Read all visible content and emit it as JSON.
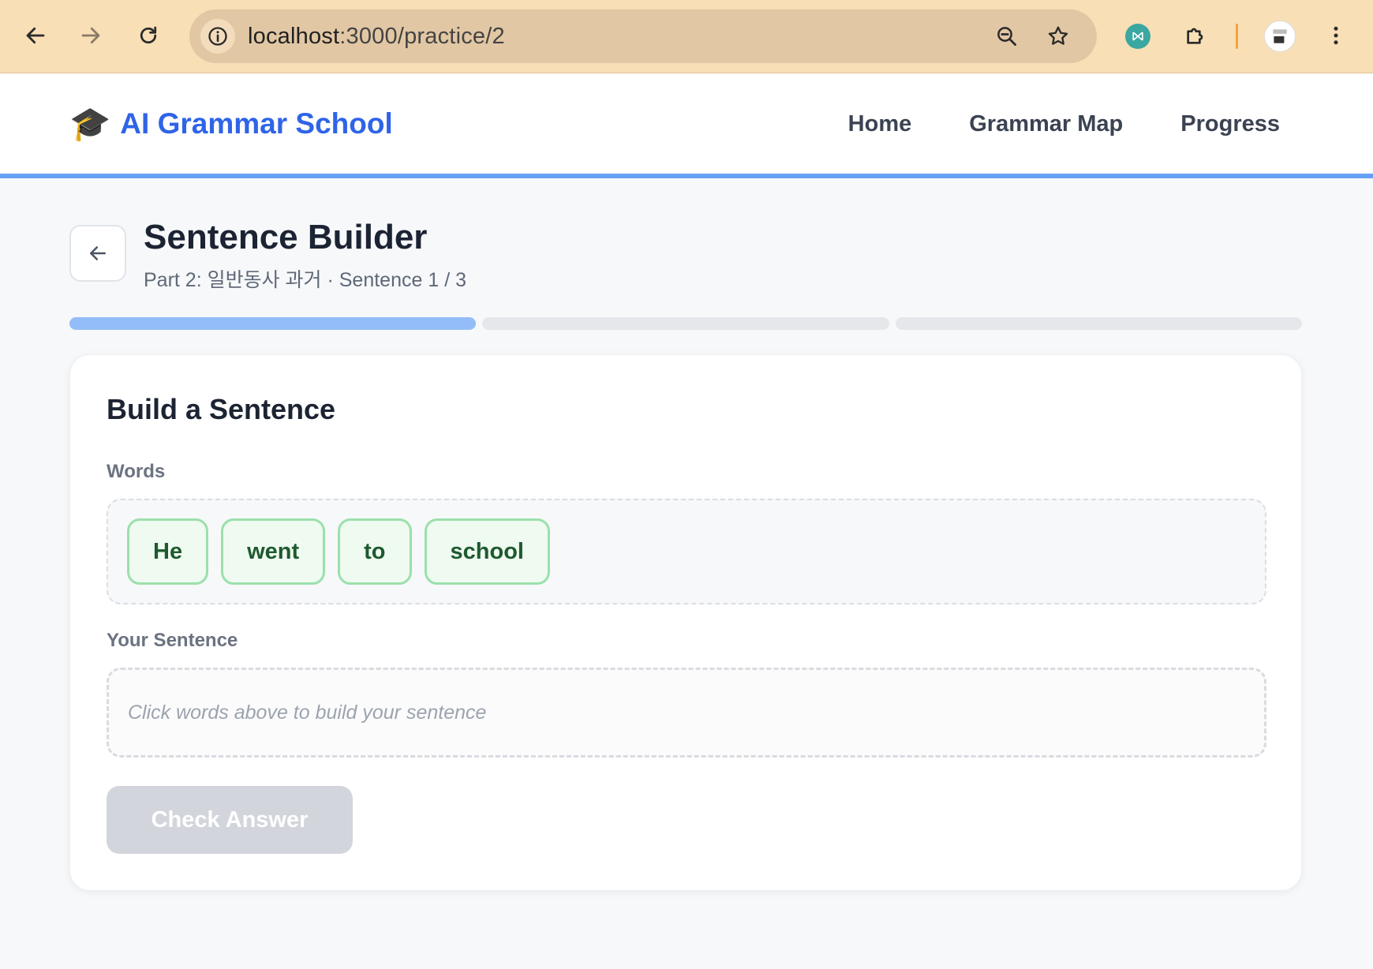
{
  "browser": {
    "url_host": "localhost",
    "url_rest": ":3000/practice/2",
    "icons": {
      "back": "back-arrow-icon",
      "forward": "forward-arrow-icon",
      "reload": "reload-icon",
      "site_info": "info-icon",
      "zoom": "zoom-out-icon",
      "bookmark": "star-icon",
      "extension1": "extension-logo-icon",
      "extensions": "puzzle-piece-icon",
      "menu": "kebab-menu-icon"
    }
  },
  "header": {
    "logo_emoji": "🎓",
    "brand": "AI Grammar School",
    "nav": [
      "Home",
      "Grammar Map",
      "Progress"
    ]
  },
  "page": {
    "title": "Sentence Builder",
    "subtitle": "Part 2: 일반동사 과거 · Sentence 1 / 3",
    "progress": {
      "current": 1,
      "total": 3
    }
  },
  "card": {
    "title": "Build a Sentence",
    "words_label": "Words",
    "words": [
      "He",
      "went",
      "to",
      "school"
    ],
    "sentence_label": "Your Sentence",
    "sentence_placeholder": "Click words above to build your sentence",
    "check_button": "Check Answer"
  },
  "colors": {
    "brand": "#2f64e8",
    "progress_done": "#93bdf8",
    "chip_border": "#9be0ab",
    "chip_text": "#1e5a2e"
  }
}
